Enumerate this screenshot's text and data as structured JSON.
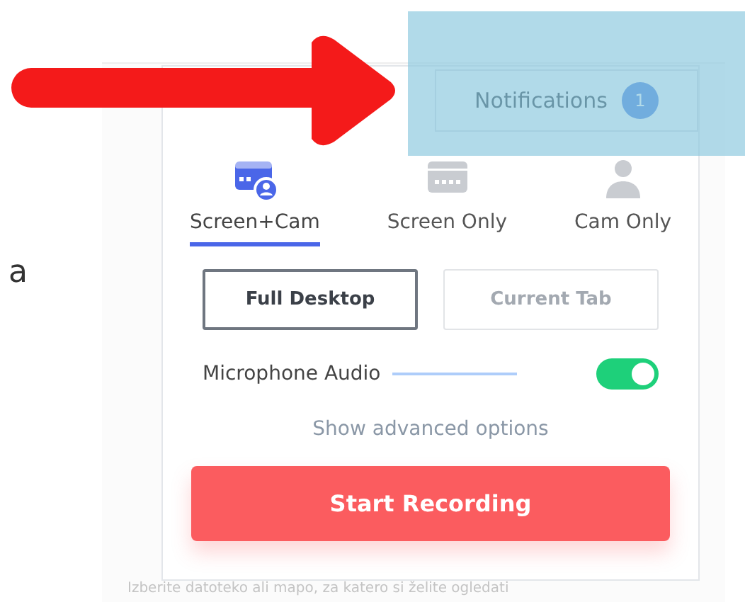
{
  "background": {
    "fragment": "a",
    "caption": "Izberite datoteko ali mapo, za katero si želite ogledati"
  },
  "notifications": {
    "label": "Notifications",
    "count": "1"
  },
  "modes": [
    {
      "kind": "screen-cam",
      "label": "Screen+Cam",
      "selected": true
    },
    {
      "kind": "screen",
      "label": "Screen Only",
      "selected": false
    },
    {
      "kind": "cam",
      "label": "Cam Only",
      "selected": false
    }
  ],
  "capture": [
    {
      "label": "Full Desktop",
      "selected": true
    },
    {
      "label": "Current Tab",
      "selected": false
    }
  ],
  "microphone": {
    "label": "Microphone Audio",
    "on": true
  },
  "advanced_link": "Show advanced options",
  "start_button": "Start Recording",
  "highlight": {
    "on": true
  },
  "arrow": {
    "on": true
  }
}
